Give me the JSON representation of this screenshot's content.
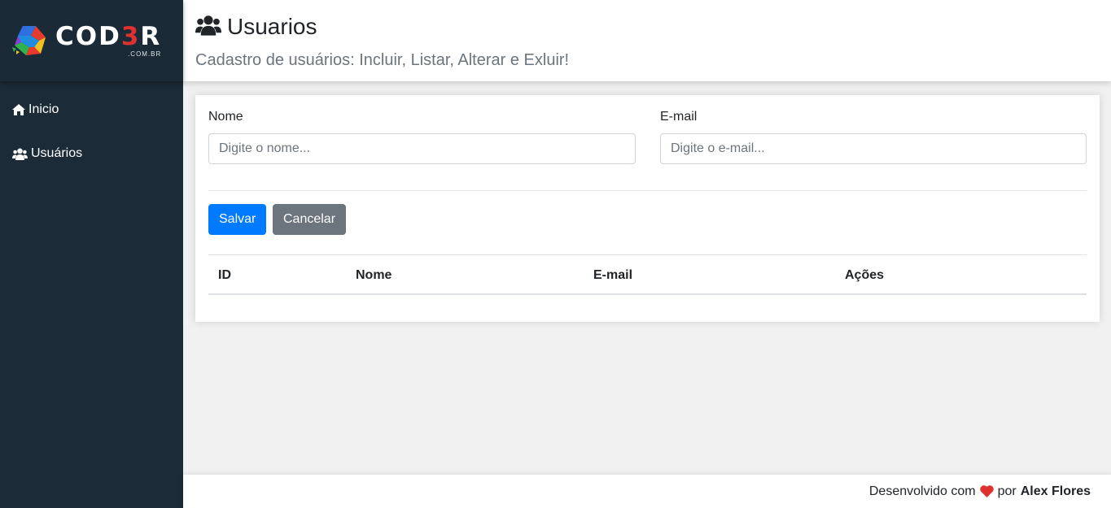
{
  "brand": {
    "logo_word_main": "COD",
    "logo_word_accent": "3",
    "logo_word_end": "R",
    "logo_domain": ".COM.BR"
  },
  "sidebar": {
    "items": [
      {
        "label": "Inicio",
        "icon": "home-icon"
      },
      {
        "label": "Usuários",
        "icon": "users-icon"
      }
    ]
  },
  "header": {
    "icon": "users-icon",
    "title": "Usuarios",
    "subtitle": "Cadastro de usuários: Incluir, Listar, Alterar e Exluir!"
  },
  "form": {
    "name_label": "Nome",
    "name_placeholder": "Digite o nome...",
    "name_value": "",
    "email_label": "E-mail",
    "email_placeholder": "Digite o e-mail...",
    "email_value": "",
    "save_label": "Salvar",
    "cancel_label": "Cancelar"
  },
  "table": {
    "columns": [
      "ID",
      "Nome",
      "E-mail",
      "Ações"
    ],
    "rows": []
  },
  "footer": {
    "text_before": "Desenvolvido com",
    "text_middle": "por",
    "author": "Alex Flores"
  },
  "colors": {
    "sidebar_bg": "#1b2b37",
    "primary": "#007bff",
    "secondary": "#6c757d",
    "heart": "#e03131"
  }
}
